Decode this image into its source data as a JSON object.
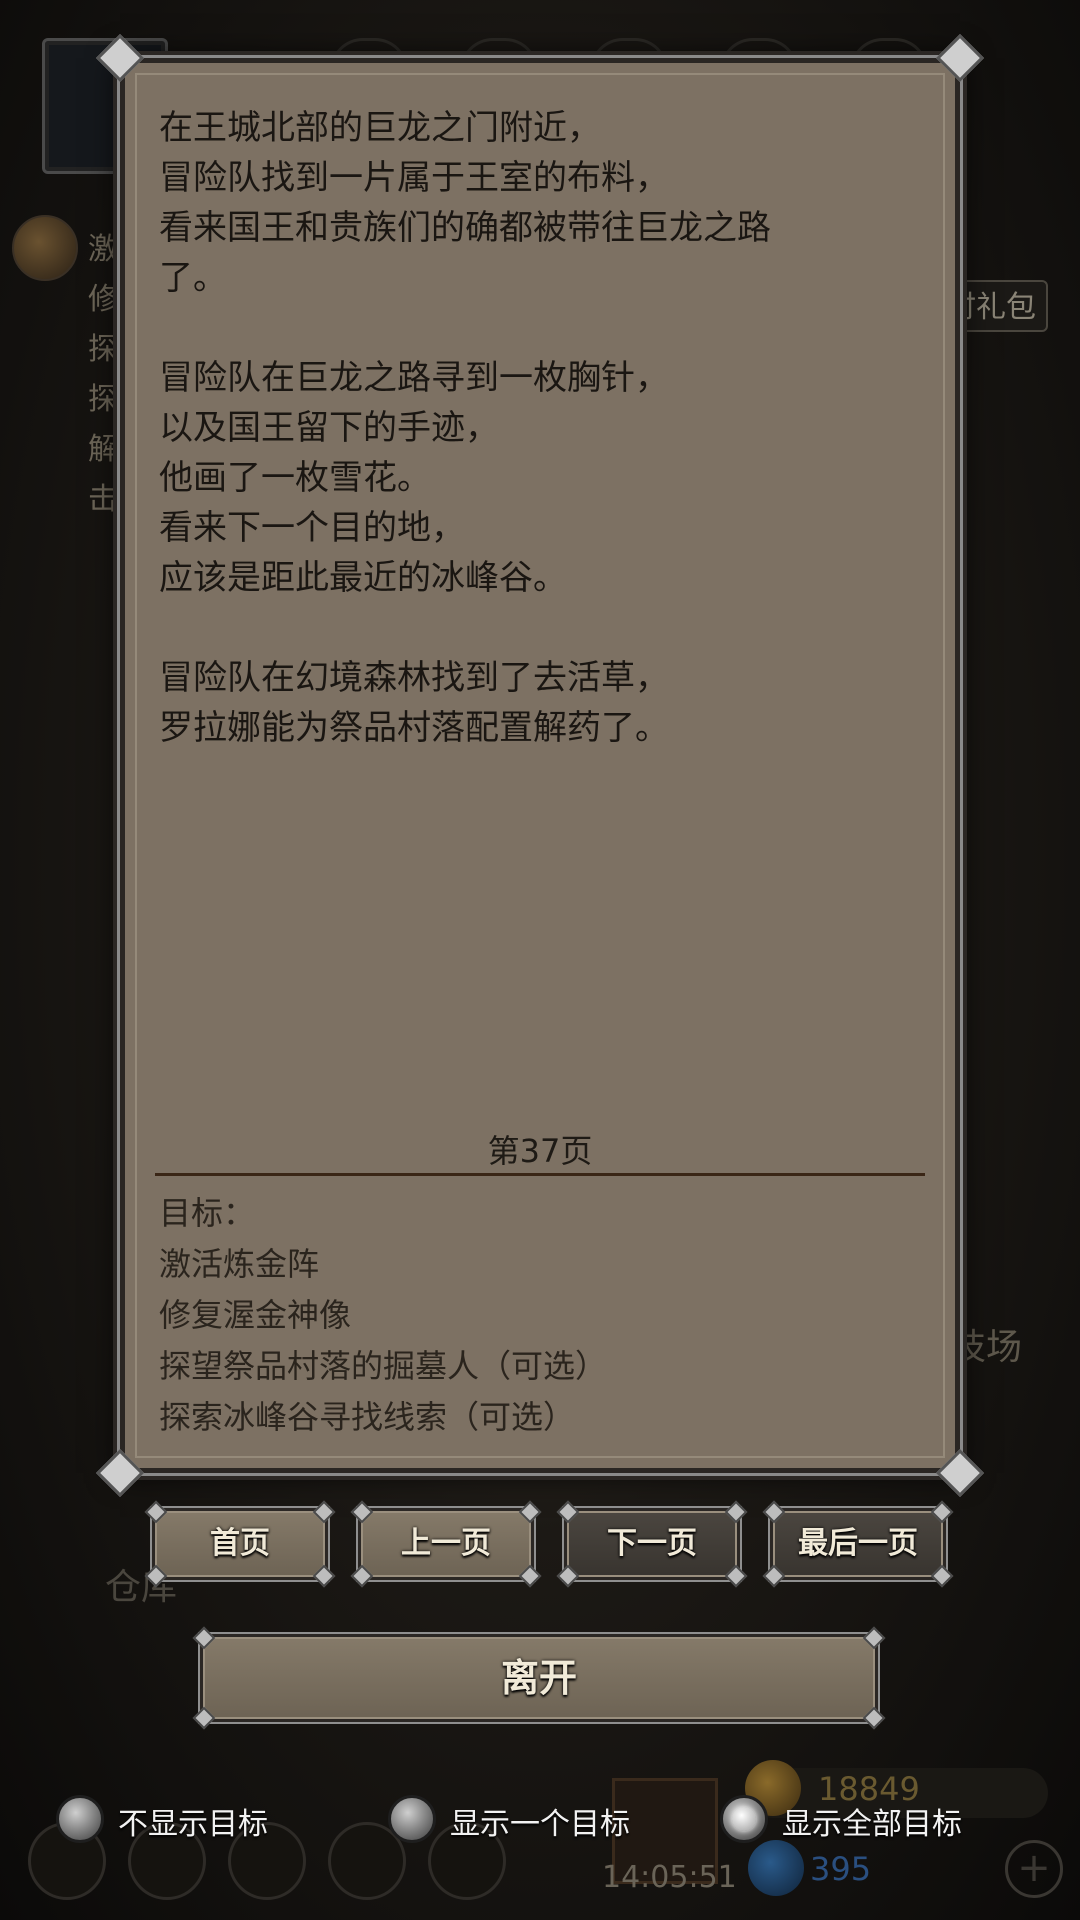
{
  "background": {
    "side_text": [
      "激",
      "修",
      "探",
      "探",
      "解",
      "击"
    ],
    "gift_button_label": "时礼包",
    "arena_label": "技场",
    "warehouse_label": "仓库",
    "gold_amount": "18849",
    "gem_amount": "395",
    "clock": "14:05:51"
  },
  "journal": {
    "lines": [
      "在王城北部的巨龙之门附近，",
      "冒险队找到一片属于王室的布料，",
      "看来国王和贵族们的确都被带往巨龙之路",
      "了。",
      "",
      "冒险队在巨龙之路寻到一枚胸针，",
      "以及国王留下的手迹，",
      "他画了一枚雪花。",
      "看来下一个目的地，",
      "应该是距此最近的冰峰谷。",
      "",
      "冒险队在幻境森林找到了去活草，",
      "罗拉娜能为祭品村落配置解药了。"
    ],
    "page_label": "第37页",
    "goals_title": "目标：",
    "goals": [
      "激活炼金阵",
      "修复渥金神像",
      "探望祭品村落的掘墓人（可选）",
      "探索冰峰谷寻找线索（可选）"
    ]
  },
  "nav": {
    "first": "首页",
    "prev": "上一页",
    "next": "下一页",
    "last": "最后一页"
  },
  "leave_label": "离开",
  "toggles": {
    "hide": "不显示目标",
    "one": "显示一个目标",
    "all": "显示全部目标",
    "selected": "all"
  },
  "colors": {
    "panel": "#7d7163",
    "text": "#1a1612",
    "divider": "#3a2616"
  }
}
